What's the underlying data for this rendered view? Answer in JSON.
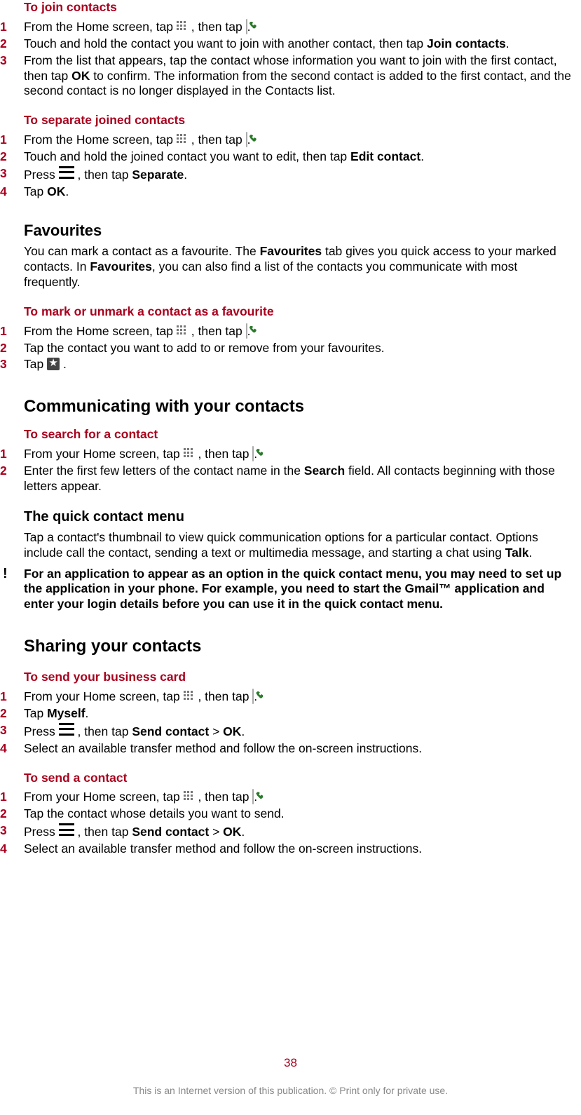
{
  "section_join": {
    "title": "To join contacts",
    "steps": [
      {
        "n": "1",
        "pre": "From the Home screen, tap ",
        "post1": ", then tap ",
        "post2": "."
      },
      {
        "n": "2",
        "t1": "Touch and hold the contact you want to join with another contact, then tap ",
        "b1": "Join contacts",
        "t2": "."
      },
      {
        "n": "3",
        "t1": "From the list that appears, tap the contact whose information you want to join with the first contact, then tap ",
        "b1": "OK",
        "t2": " to confirm. The information from the second contact is added to the first contact, and the second contact is no longer displayed in the Contacts list."
      }
    ]
  },
  "section_separate": {
    "title": "To separate joined contacts",
    "steps": [
      {
        "n": "1",
        "pre": "From the Home screen, tap ",
        "post1": ", then tap ",
        "post2": "."
      },
      {
        "n": "2",
        "t1": "Touch and hold the joined contact you want to edit, then tap ",
        "b1": "Edit contact",
        "t2": "."
      },
      {
        "n": "3",
        "t1": "Press ",
        "t2": ", then tap ",
        "b1": "Separate",
        "t3": "."
      },
      {
        "n": "4",
        "t1": "Tap ",
        "b1": "OK",
        "t2": "."
      }
    ]
  },
  "section_fav": {
    "title": "Favourites",
    "p1": "You can mark a contact as a favourite. The ",
    "b1": "Favourites",
    "p2": " tab gives you quick access to your marked contacts. In ",
    "b2": "Favourites",
    "p3": ", you can also find a list of the contacts you communicate with most frequently.",
    "sub": "To mark or unmark a contact as a favourite",
    "steps": [
      {
        "n": "1",
        "pre": "From the Home screen, tap ",
        "post1": ", then tap ",
        "post2": "."
      },
      {
        "n": "2",
        "t": "Tap the contact you want to add to or remove from your favourites."
      },
      {
        "n": "3",
        "t1": "Tap ",
        "t2": "."
      }
    ]
  },
  "section_comm": {
    "title": "Communicating with your contacts",
    "sub": "To search for a contact",
    "steps": [
      {
        "n": "1",
        "pre": "From your Home screen, tap ",
        "post1": ", then tap ",
        "post2": "."
      },
      {
        "n": "2",
        "t1": "Enter the first few letters of the contact name in the ",
        "b1": "Search",
        "t2": " field. All contacts beginning with those letters appear."
      }
    ]
  },
  "section_quick": {
    "title": "The quick contact menu",
    "p1": "Tap a contact's thumbnail to view quick communication options for a particular contact. Options include call the contact, sending a text or multimedia message, and starting a chat using ",
    "b1": "Talk",
    "p2": ".",
    "note": "For an application to appear as an option in the quick contact menu, you may need to set up the application in your phone. For example, you need to start the  Gmail™  application and enter your login details before you can use it in the quick contact menu."
  },
  "section_share": {
    "title": "Sharing your contacts",
    "sub1": "To send your business card",
    "steps1": [
      {
        "n": "1",
        "pre": "From your Home screen, tap ",
        "post1": ", then tap ",
        "post2": "."
      },
      {
        "n": "2",
        "t1": "Tap ",
        "b1": "Myself",
        "t2": "."
      },
      {
        "n": "3",
        "t1": "Press ",
        "t2": ", then tap ",
        "b1": "Send contact",
        "t3": " > ",
        "b2": "OK",
        "t4": "."
      },
      {
        "n": "4",
        "t": "Select an available transfer method and follow the on-screen instructions."
      }
    ],
    "sub2": "To send a contact",
    "steps2": [
      {
        "n": "1",
        "pre": "From your Home screen, tap ",
        "post1": ", then tap ",
        "post2": "."
      },
      {
        "n": "2",
        "t": "Tap the contact whose details you want to send."
      },
      {
        "n": "3",
        "t1": "Press ",
        "t2": ", then tap ",
        "b1": "Send contact",
        "t3": " > ",
        "b2": "OK",
        "t4": "."
      },
      {
        "n": "4",
        "t": "Select an available transfer method and follow the on-screen instructions."
      }
    ]
  },
  "footer": {
    "page": "38",
    "text": "This is an Internet version of this publication. © Print only for private use."
  }
}
